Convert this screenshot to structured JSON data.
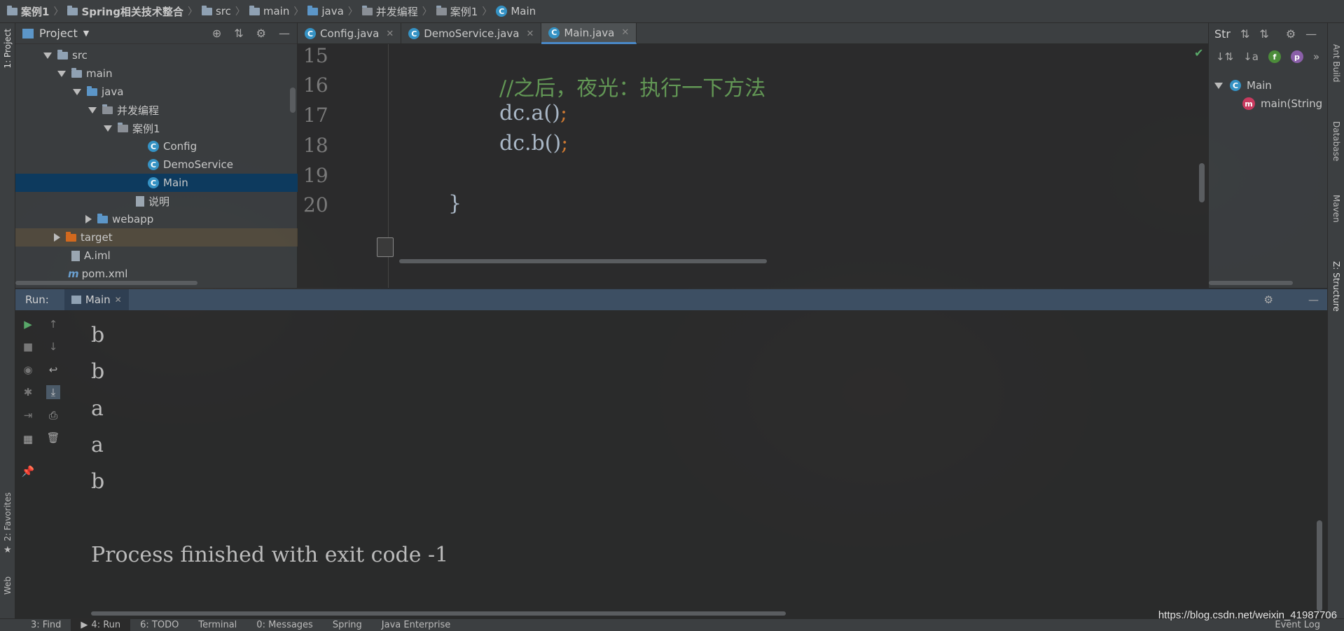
{
  "breadcrumb": [
    "案例1",
    "Spring相关技术整合",
    "src",
    "main",
    "java",
    "并发编程",
    "案例1",
    "Main"
  ],
  "left_strip": {
    "project_tab": "1: Project",
    "favorites_tab": "2: Favorites",
    "web_tab": "Web"
  },
  "right_strip": {
    "ant_build": "Ant Build",
    "database": "Database",
    "maven": "Maven",
    "structure": "Z: Structure"
  },
  "project_panel": {
    "title": "Project",
    "tree": [
      {
        "label": "src",
        "type": "folder"
      },
      {
        "label": "main",
        "type": "folder"
      },
      {
        "label": "java",
        "type": "folder-blue"
      },
      {
        "label": "并发编程",
        "type": "package"
      },
      {
        "label": "案例1",
        "type": "package"
      },
      {
        "label": "Config",
        "type": "class"
      },
      {
        "label": "DemoService",
        "type": "class"
      },
      {
        "label": "Main",
        "type": "class-main"
      },
      {
        "label": "说明",
        "type": "file"
      },
      {
        "label": "webapp",
        "type": "folder-web"
      },
      {
        "label": "target",
        "type": "folder-orange"
      },
      {
        "label": "A.iml",
        "type": "file"
      },
      {
        "label": "pom.xml",
        "type": "maven"
      }
    ]
  },
  "editor_tabs": [
    {
      "label": "Config.java",
      "active": false
    },
    {
      "label": "DemoService.java",
      "active": false
    },
    {
      "label": "Main.java",
      "active": true
    }
  ],
  "editor": {
    "line_numbers": [
      "15",
      "16",
      "17",
      "18",
      "19",
      "20"
    ],
    "lines": {
      "comment": "//之后，夜光：执行一下方法",
      "line17_code": "dc.a()",
      "line18_code": "dc.b()",
      "semicolon": ";",
      "closing_brace": "}"
    }
  },
  "structure_panel": {
    "title": "Str",
    "tree": [
      {
        "label": "Main",
        "type": "class"
      },
      {
        "label": "main(String",
        "type": "method"
      }
    ]
  },
  "run_panel": {
    "label": "Run:",
    "tab": "Main",
    "console": [
      "b",
      "b",
      "a",
      "a",
      "b",
      "",
      "Process finished with exit code -1"
    ]
  },
  "bottom_tabs": [
    "3: Find",
    "4: Run",
    "6: TODO",
    "Terminal",
    "0: Messages",
    "Spring",
    "Java Enterprise"
  ],
  "bottom_right": "Event Log",
  "watermark": "https://blog.csdn.net/weixin_41987706",
  "colors": {
    "accent": "#4a88c7",
    "selection": "#0d3a5e",
    "comment": "#629755",
    "keyword": "#cc7832",
    "run_header": "#3d4f63"
  }
}
